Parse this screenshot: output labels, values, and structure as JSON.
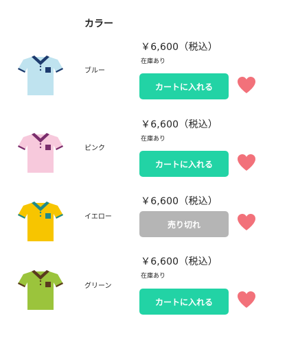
{
  "header": {
    "title": "カラー"
  },
  "colors": {
    "accent": "#22d3a5",
    "sold_out": "#b5b5b5",
    "heart": "#f2717a"
  },
  "items": [
    {
      "name": "ブルー",
      "price": "￥6,600（税込）",
      "stock": "在庫あり",
      "button_label": "カートに入れる",
      "shirt_color": "#bfe3ef",
      "accent_color": "#1d3b6e",
      "icon": "polo-shirt-icon"
    },
    {
      "name": "ピンク",
      "price": "￥6,600（税込）",
      "stock": "在庫あり",
      "button_label": "カートに入れる",
      "shirt_color": "#f7c9dc",
      "accent_color": "#7a2d6c",
      "icon": "polo-shirt-icon"
    },
    {
      "name": "イエロー",
      "price": "￥6,600（税込）",
      "stock": "",
      "button_label": "売り切れ",
      "shirt_color": "#f7c500",
      "accent_color": "#1f8a8a",
      "icon": "polo-shirt-icon"
    },
    {
      "name": "グリーン",
      "price": "￥6,600（税込）",
      "stock": "在庫あり",
      "button_label": "カートに入れる",
      "shirt_color": "#9bc43c",
      "accent_color": "#5a3a1e",
      "icon": "polo-shirt-icon"
    }
  ]
}
